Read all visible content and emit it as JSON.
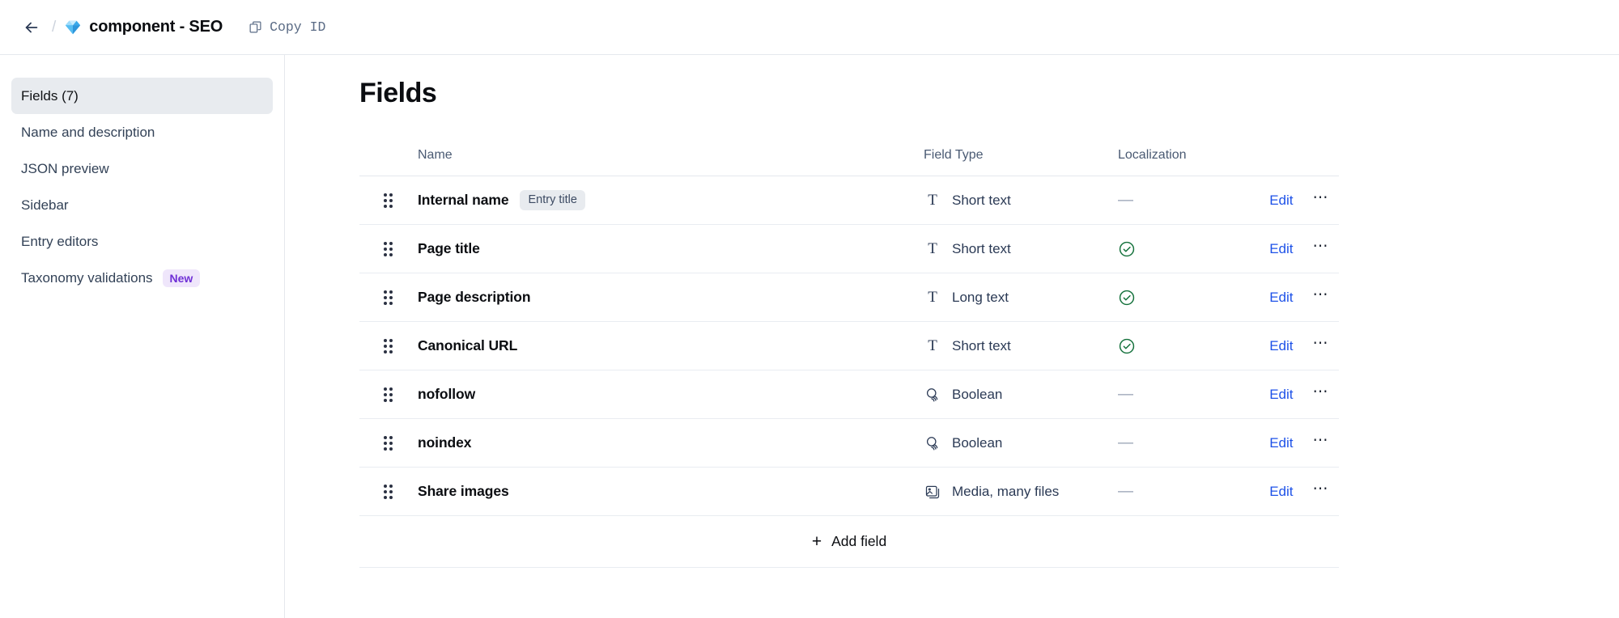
{
  "header": {
    "back_icon": "arrow-left-icon",
    "breadcrumb_separator": "/",
    "gem_icon": "gem-icon",
    "title": "component - SEO",
    "copy_id_label": "Copy ID",
    "copy_icon": "copy-icon"
  },
  "sidebar": {
    "items": [
      {
        "label": "Fields (7)",
        "active": true,
        "badge": ""
      },
      {
        "label": "Name and description",
        "active": false,
        "badge": ""
      },
      {
        "label": "JSON preview",
        "active": false,
        "badge": ""
      },
      {
        "label": "Sidebar",
        "active": false,
        "badge": ""
      },
      {
        "label": "Entry editors",
        "active": false,
        "badge": ""
      },
      {
        "label": "Taxonomy validations",
        "active": false,
        "badge": "New"
      }
    ]
  },
  "main": {
    "heading": "Fields",
    "columns": {
      "name": "Name",
      "field_type": "Field Type",
      "localization": "Localization"
    },
    "rows": [
      {
        "name": "Internal name",
        "tag": "Entry title",
        "type": "Short text",
        "type_icon": "text-t-icon",
        "localized": false,
        "edit": "Edit",
        "more": "⋯"
      },
      {
        "name": "Page title",
        "tag": "",
        "type": "Short text",
        "type_icon": "text-t-icon",
        "localized": true,
        "edit": "Edit",
        "more": "⋯"
      },
      {
        "name": "Page description",
        "tag": "",
        "type": "Long text",
        "type_icon": "text-t-icon",
        "localized": true,
        "edit": "Edit",
        "more": "⋯"
      },
      {
        "name": "Canonical URL",
        "tag": "",
        "type": "Short text",
        "type_icon": "text-t-icon",
        "localized": true,
        "edit": "Edit",
        "more": "⋯"
      },
      {
        "name": "nofollow",
        "tag": "",
        "type": "Boolean",
        "type_icon": "boolean-icon",
        "localized": false,
        "edit": "Edit",
        "more": "⋯"
      },
      {
        "name": "noindex",
        "tag": "",
        "type": "Boolean",
        "type_icon": "boolean-icon",
        "localized": false,
        "edit": "Edit",
        "more": "⋯"
      },
      {
        "name": "Share images",
        "tag": "",
        "type": "Media, many files",
        "type_icon": "media-icon",
        "localized": false,
        "edit": "Edit",
        "more": "⋯"
      }
    ],
    "add_field_label": "Add field",
    "add_field_icon": "plus-icon",
    "localization_empty": "—"
  },
  "colors": {
    "link": "#1e52e8",
    "badge_new_bg": "#efe6fb",
    "badge_new_text": "#6f2fd6",
    "badge_tag_bg": "#e8ebef",
    "active_nav_bg": "#e8ebef",
    "check_green": "#12703a",
    "border": "#e5e8ed"
  }
}
